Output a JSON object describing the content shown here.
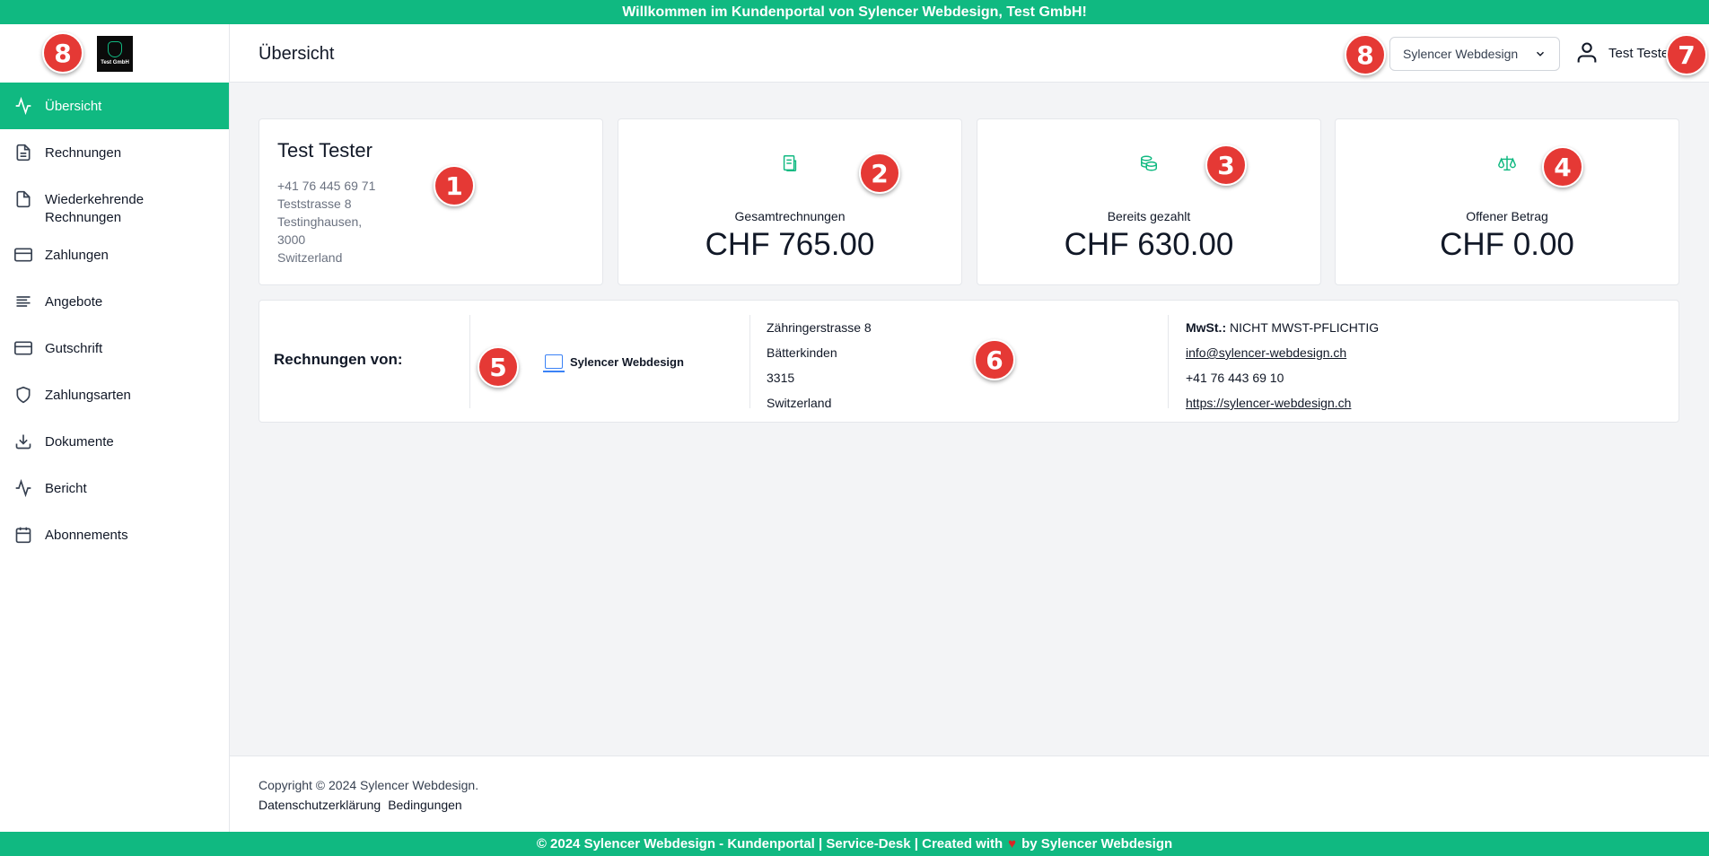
{
  "banner": {
    "text": "Willkommen im Kundenportal von Sylencer Webdesign, Test GmbH!"
  },
  "sidebar": {
    "logo_text": "Test GmbH",
    "items": [
      {
        "label": "Übersicht",
        "icon": "activity-icon"
      },
      {
        "label": "Rechnungen",
        "icon": "file-text-icon"
      },
      {
        "label": "Wiederkehrende Rechnungen",
        "icon": "file-icon"
      },
      {
        "label": "Zahlungen",
        "icon": "credit-card-icon"
      },
      {
        "label": "Angebote",
        "icon": "align-left-icon"
      },
      {
        "label": "Gutschrift",
        "icon": "credit-card-icon"
      },
      {
        "label": "Zahlungsarten",
        "icon": "shield-icon"
      },
      {
        "label": "Dokumente",
        "icon": "download-icon"
      },
      {
        "label": "Bericht",
        "icon": "activity-icon"
      },
      {
        "label": "Abonnements",
        "icon": "calendar-icon"
      }
    ]
  },
  "header": {
    "title": "Übersicht",
    "company_select": "Sylencer Webdesign",
    "user_name": "Test Tester"
  },
  "profile": {
    "name": "Test Tester",
    "phone": "+41 76 445 69 71",
    "street": "Teststrasse 8",
    "city": "Testinghausen,",
    "zip": "3000",
    "country": "Switzerland"
  },
  "stats": [
    {
      "label": "Gesamtrechnungen",
      "value": "CHF 765.00",
      "icon": "document-icon"
    },
    {
      "label": "Bereits gezahlt",
      "value": "CHF 630.00",
      "icon": "coins-icon"
    },
    {
      "label": "Offener Betrag",
      "value": "CHF 0.00",
      "icon": "scale-icon"
    }
  ],
  "invoice_from": {
    "heading": "Rechnungen von:",
    "company": "Sylencer Webdesign",
    "address": [
      "Zähringerstrasse 8",
      "Bätterkinden",
      "3315",
      "Switzerland"
    ],
    "vat_label": "MwSt.:",
    "vat_value": "NICHT MWST-PFLICHTIG",
    "email": "info@sylencer-webdesign.ch",
    "phone": "+41 76 443 69 10",
    "website": "https://sylencer-webdesign.ch"
  },
  "footer": {
    "copyright": "Copyright © 2024 Sylencer Webdesign.",
    "privacy": "Datenschutzerklärung",
    "terms": "Bedingungen"
  },
  "bottom_bar": {
    "prefix": "© 2024 Sylencer Webdesign - Kundenportal | Service-Desk | Created with",
    "suffix": "by Sylencer Webdesign"
  },
  "annotations": [
    "1",
    "2",
    "3",
    "4",
    "5",
    "6",
    "7",
    "8",
    "8"
  ],
  "colors": {
    "accent": "#10b981",
    "badge": "#e53935",
    "background": "#f3f4f6"
  }
}
